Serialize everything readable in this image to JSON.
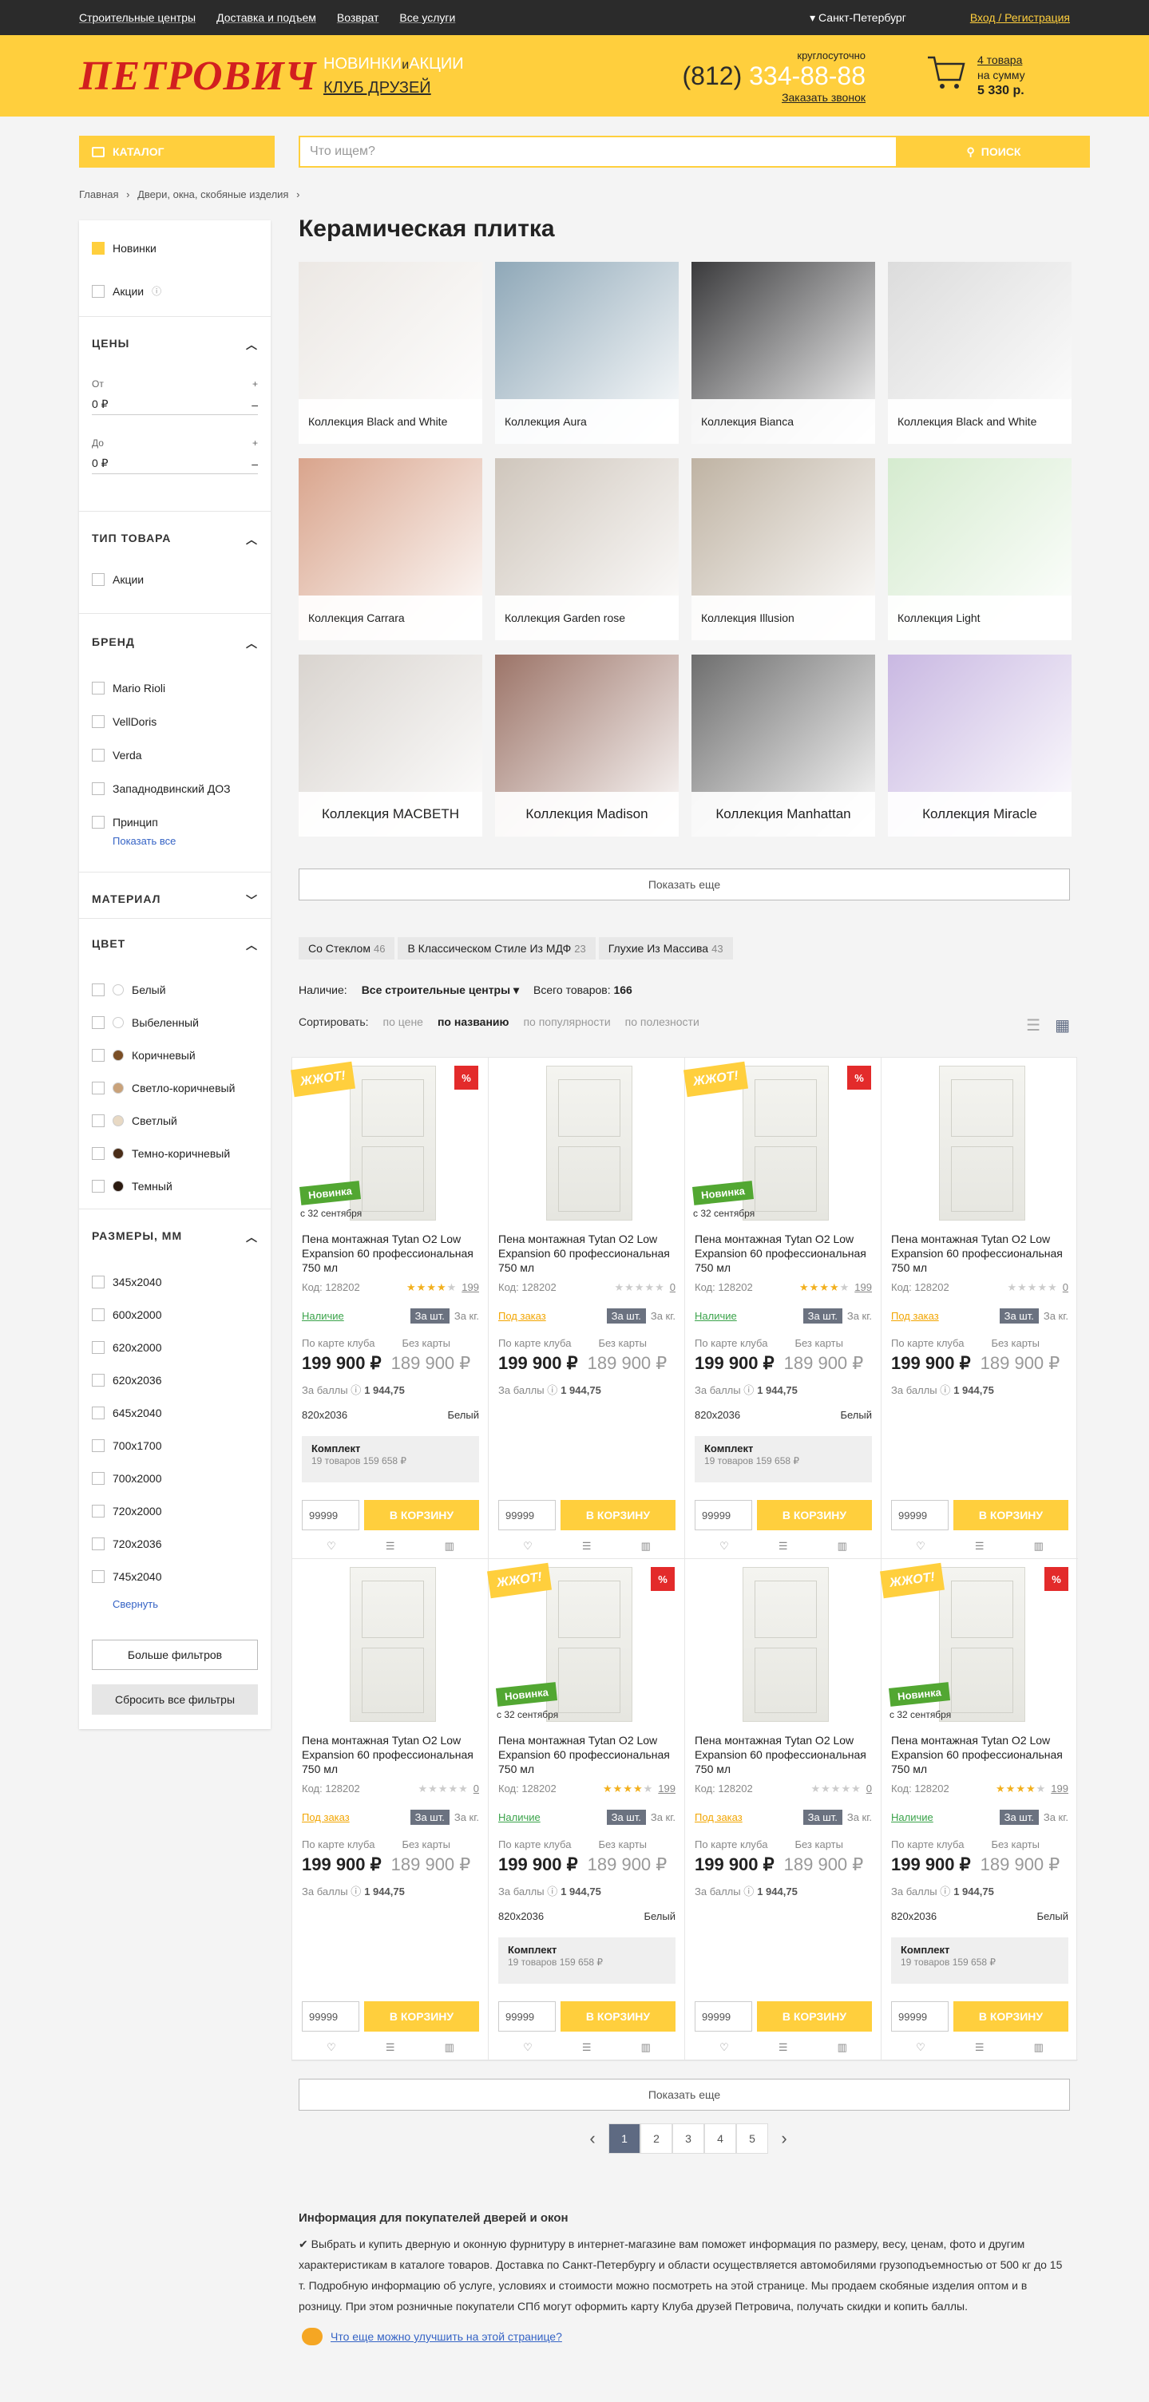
{
  "topbar": {
    "links": [
      "Строительные центры",
      "Доставка и подъем",
      "Возврат",
      "Все услуги"
    ],
    "city": "▾ Санкт-Петербург",
    "login": "Вход / Регистрация"
  },
  "header": {
    "logo": "ПЕТРОВИЧ",
    "promo_new": "НОВИНКИ",
    "promo_and": "и",
    "promo_sales": "АКЦИИ",
    "club": "КЛУБ ДРУЗЕЙ",
    "phone_note": "круглосуточно",
    "phone_code": "(812)",
    "phone_number": "334-88-88",
    "call": "Заказать звонок",
    "cart_count": "4 товара",
    "cart_sum_label": "на сумму",
    "cart_sum": "5 330 р."
  },
  "search": {
    "catalog": "КАТАЛОГ",
    "placeholder": "Что ищем?",
    "button": "ПОИСК"
  },
  "breadcrumbs": [
    "Главная",
    "›",
    "Двери, окна, скобяные изделия",
    "›"
  ],
  "sidebar": {
    "new": "Новинки",
    "sales": "Акции",
    "price_head": "ЦЕНЫ",
    "from": "От",
    "to": "До",
    "zero": "0 ₽",
    "plus": "+",
    "minus": "–",
    "type_head": "ТИП ТОВАРА",
    "type_item": "Акции",
    "brand_head": "БРЕНД",
    "brands": [
      "Mario Rioli",
      "VellDoris",
      "Verda",
      "Западнодвинский ДОЗ",
      "Принцип"
    ],
    "show_all": "Показать все",
    "material_head": "МАТЕРИАЛ",
    "color_head": "ЦВЕТ",
    "colors": [
      {
        "name": "Белый",
        "hex": "#ffffff"
      },
      {
        "name": "Выбеленный",
        "hex": "#ffffff"
      },
      {
        "name": "Коричневый",
        "hex": "#7a4e25"
      },
      {
        "name": "Светло-коричневый",
        "hex": "#c9a27a"
      },
      {
        "name": "Светлый",
        "hex": "#e8d9c4"
      },
      {
        "name": "Темно-коричневый",
        "hex": "#4a2d18"
      },
      {
        "name": "Темный",
        "hex": "#2b1a10"
      }
    ],
    "size_head": "РАЗМЕРЫ, ММ",
    "sizes": [
      "345x2040",
      "600x2000",
      "620x2000",
      "620x2036",
      "645x2040",
      "700x1700",
      "700x2000",
      "720x2000",
      "720x2036",
      "745x2040"
    ],
    "collapse": "Свернуть",
    "more_filters": "Больше фильтров",
    "reset": "Сбросить все фильтры"
  },
  "main": {
    "title": "Керамическая плитка",
    "show_more": "Показать еще"
  },
  "collections": [
    {
      "name": "Коллекция Black and White",
      "big": false,
      "bg": "#ece8e4"
    },
    {
      "name": "Коллекция Aura",
      "big": false,
      "bg": "#8fa8b8"
    },
    {
      "name": "Коллекция Bianca",
      "big": false,
      "bg": "#3a3a3c"
    },
    {
      "name": "Коллекция Black and White",
      "big": false,
      "bg": "#dcdcdc"
    },
    {
      "name": "Коллекция Carrara",
      "big": false,
      "bg": "#d9a48c"
    },
    {
      "name": "Коллекция Garden rose",
      "big": false,
      "bg": "#cfc6bc"
    },
    {
      "name": "Коллекция Illusion",
      "big": false,
      "bg": "#bfb3a3"
    },
    {
      "name": "Коллекция Light",
      "big": false,
      "bg": "#d5ebcf"
    },
    {
      "name": "Коллекция MACBETH",
      "big": true,
      "bg": "#d9d4cf"
    },
    {
      "name": "Коллекция Madison",
      "big": true,
      "bg": "#9c7468"
    },
    {
      "name": "Коллекция Manhattan",
      "big": true,
      "bg": "#6e6e6e"
    },
    {
      "name": "Коллекция Miracle",
      "big": true,
      "bg": "#c9b8e2"
    }
  ],
  "tags": [
    {
      "name": "Со Стеклом",
      "count": "46"
    },
    {
      "name": "В Классическом Стиле Из МДФ",
      "count": "23"
    },
    {
      "name": "Глухие Из Массива",
      "count": "43"
    }
  ],
  "availability": {
    "label": "Наличие:",
    "value": "Все строительные центры ▾",
    "total_label": "Всего товаров:",
    "total": "166"
  },
  "sort": {
    "label": "Сортировать:",
    "options": [
      "по цене",
      "по названию",
      "по популярности",
      "по полезности"
    ]
  },
  "product": {
    "title": "Пена монтажная Tytan O2 Low Expansion 60 профессиональная 750 мл",
    "code": "Код: 128202",
    "price_club_label": "По карте клуба",
    "price_nocard_label": "Без карты",
    "price_club": "199 900 ₽",
    "price_old": "189 900 ₽",
    "bonus": "За баллы ⓘ",
    "bonus_val": "1 944,75",
    "size": "820x2036",
    "color": "Белый",
    "kit": "Комплект",
    "kit_note": "19 товаров 159 658 ₽",
    "qty": "99999",
    "buy": "В КОРЗИНУ",
    "unit": "За шт.",
    "unit2": "За кг.",
    "hot": "ЖЖОТ!",
    "pct": "%",
    "new": "Новинка",
    "new_date": "с 32 сентября",
    "in_stock": "Наличие",
    "to_order": "Под заказ",
    "reviews": "199",
    "zero": "0"
  },
  "cards": [
    {
      "hot": true,
      "isnew": true,
      "stock": true,
      "rated": true,
      "kit": true
    },
    {
      "hot": false,
      "isnew": false,
      "stock": false,
      "rated": false,
      "kit": false
    },
    {
      "hot": true,
      "isnew": true,
      "stock": true,
      "rated": true,
      "kit": true
    },
    {
      "hot": false,
      "isnew": false,
      "stock": false,
      "rated": false,
      "kit": false
    },
    {
      "hot": false,
      "isnew": false,
      "stock": false,
      "rated": false,
      "kit": false
    },
    {
      "hot": true,
      "isnew": true,
      "stock": true,
      "rated": true,
      "kit": true
    },
    {
      "hot": false,
      "isnew": false,
      "stock": false,
      "rated": false,
      "kit": false
    },
    {
      "hot": true,
      "isnew": true,
      "stock": true,
      "rated": true,
      "kit": true
    }
  ],
  "pager": {
    "pages": [
      "1",
      "2",
      "3",
      "4",
      "5"
    ],
    "prev": "‹",
    "next": "›"
  },
  "info": {
    "title": "Информация для покупателей дверей и окон",
    "text": "✔ Выбрать и купить дверную и оконную фурнитуру в интернет-магазине вам поможет информация по размеру, весу, ценам, фото и другим характеристикам в каталоге товаров. Доставка по Санкт-Петербургу и области осуществляется автомобилями грузоподъемностью от 500 кг до 15 т. Подробную информацию об услуге, условиях и стоимости можно посмотреть на этой странице. Мы продаем скобяные изделия оптом и в розницу. При этом розничные покупатели СПб могут оформить карту Клуба друзей Петровича, получать скидки и копить баллы.",
    "feedback": "Что еще можно улучшить на этой странице?"
  },
  "colors": {
    "accent": "#ffcf3d",
    "dark": "#2b2b2b",
    "red": "#d21f1f",
    "green": "#52a732"
  }
}
